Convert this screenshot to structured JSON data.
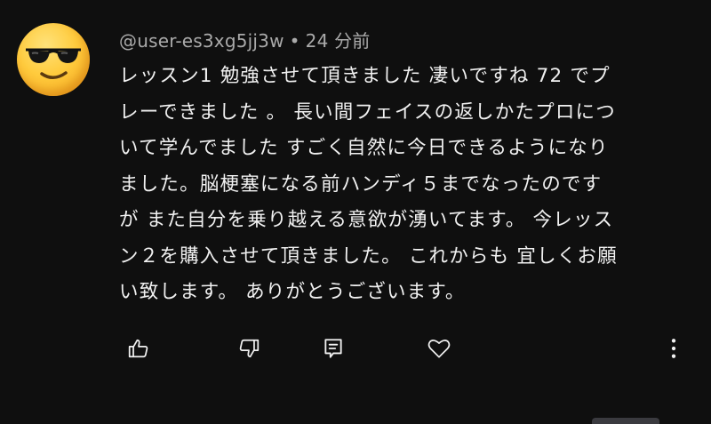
{
  "comment": {
    "avatar_icon": "sunglasses-emoji-icon",
    "author": "@user-es3xg5jj3w",
    "separator": "•",
    "time": "24 分前",
    "lines": [
      "レッスン1  勉強させて頂きました 凄いですね 72 でプ",
      "レーできました 。 長い間フェイスの返しかたプロにつ",
      "いて学んでました すごく自然に今日できるようになり",
      "ました。脳梗塞になる前ハンディ５までなったのです",
      "が また自分を乗り越える意欲が湧いてます。 今レッス",
      "ン２を購入させて頂きました。 これからも 宜しくお願",
      "い致します。 ありがとうございます。"
    ]
  },
  "actions": {
    "like_icon": "thumbs-up-icon",
    "dislike_icon": "thumbs-down-icon",
    "reply_icon": "reply-comment-icon",
    "heart_icon": "heart-icon",
    "more_icon": "more-vertical-icon"
  },
  "colors": {
    "background": "#0f0f0f",
    "text": "#f1f1f1",
    "meta": "#aaaaaa"
  }
}
